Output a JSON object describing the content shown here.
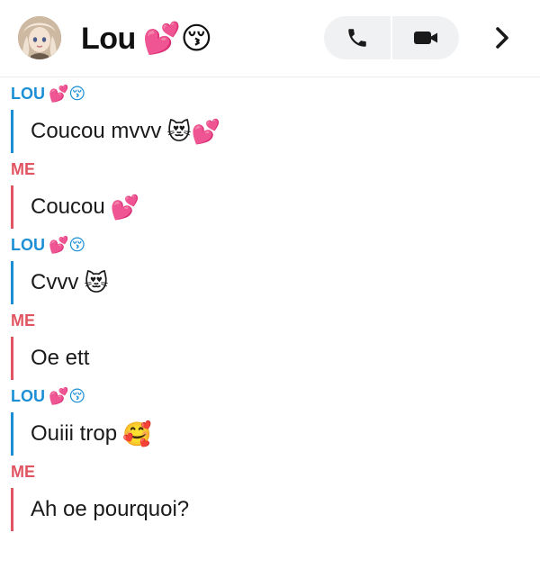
{
  "header": {
    "name": "Lou",
    "name_emoji": "💕😚",
    "icons": {
      "avatar": "avatar-image",
      "call": "phone-icon",
      "video": "video-camera-icon",
      "more": "chevron-right-icon"
    }
  },
  "sender_labels": {
    "lou": "LOU",
    "lou_emoji": "💕😚",
    "me": "ME"
  },
  "messages": [
    {
      "from": "LOU",
      "text": "Coucou mvvv",
      "emoji": "😻💕"
    },
    {
      "from": "ME",
      "text": "Coucou",
      "emoji": "💕"
    },
    {
      "from": "LOU",
      "text": "Cvvv",
      "emoji": "😻"
    },
    {
      "from": "ME",
      "text": "Oe ett",
      "emoji": ""
    },
    {
      "from": "LOU",
      "text": "Ouiii trop",
      "emoji": "🥰"
    },
    {
      "from": "ME",
      "text": "Ah oe pourquoi?",
      "emoji": ""
    }
  ],
  "colors": {
    "lou": "#1b8fd6",
    "me": "#e05561",
    "call_group_bg": "#f0f1f2"
  }
}
